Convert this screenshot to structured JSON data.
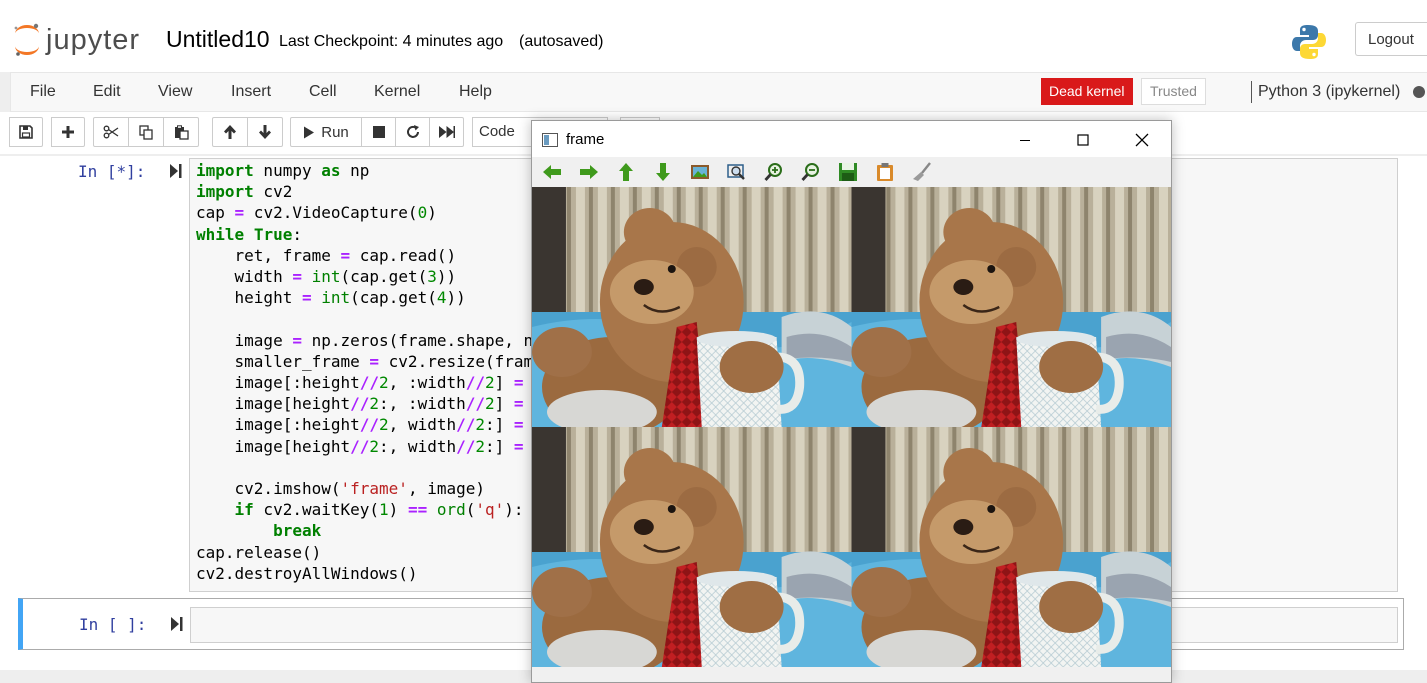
{
  "header": {
    "logo_text": "jupyter",
    "notebook_title": "Untitled10",
    "checkpoint": "Last Checkpoint: 4 minutes ago",
    "autosave_status": "(autosaved)",
    "logout_label": "Logout"
  },
  "menubar": {
    "items": [
      "File",
      "Edit",
      "View",
      "Insert",
      "Cell",
      "Kernel",
      "Help"
    ],
    "kernel_status": "Dead kernel",
    "trusted_label": "Trusted",
    "kernel_name": "Python 3 (ipykernel)"
  },
  "toolbar": {
    "run_label": "Run",
    "cell_type": "Code"
  },
  "cells": [
    {
      "prompt": "In [*]:",
      "code_lines": [
        "import numpy as np",
        "import cv2",
        "cap = cv2.VideoCapture(0)",
        "while True:",
        "    ret, frame = cap.read()",
        "    width = int(cap.get(3))",
        "    height = int(cap.get(4))",
        "",
        "    image = np.zeros(frame.shape, n",
        "    smaller_frame = cv2.resize(fram",
        "    image[:height//2, :width//2] = ",
        "    image[height//2:, :width//2] = ",
        "    image[:height//2, width//2:] = ",
        "    image[height//2:, width//2:] = ",
        "",
        "    cv2.imshow('frame', image)",
        "    if cv2.waitKey(1) == ord('q'):",
        "        break",
        "cap.release()",
        "cv2.destroyAllWindows()"
      ]
    },
    {
      "prompt": "In [ ]:",
      "code_lines": []
    }
  ],
  "cv_window": {
    "title": "frame",
    "toolbar_icons": [
      "arrow-left-icon",
      "arrow-right-icon",
      "arrow-up-icon",
      "arrow-down-icon",
      "image-icon",
      "zoom-fit-icon",
      "zoom-in-icon",
      "zoom-out-icon",
      "save-icon",
      "clipboard-icon",
      "brush-icon"
    ]
  },
  "colors": {
    "dead_kernel": "#d9191a",
    "prompt_in": "#303f9f",
    "selected_cell_border": "#42a5f5",
    "keyword": "#008000",
    "operator": "#aa22ff",
    "string": "#ba2121"
  }
}
